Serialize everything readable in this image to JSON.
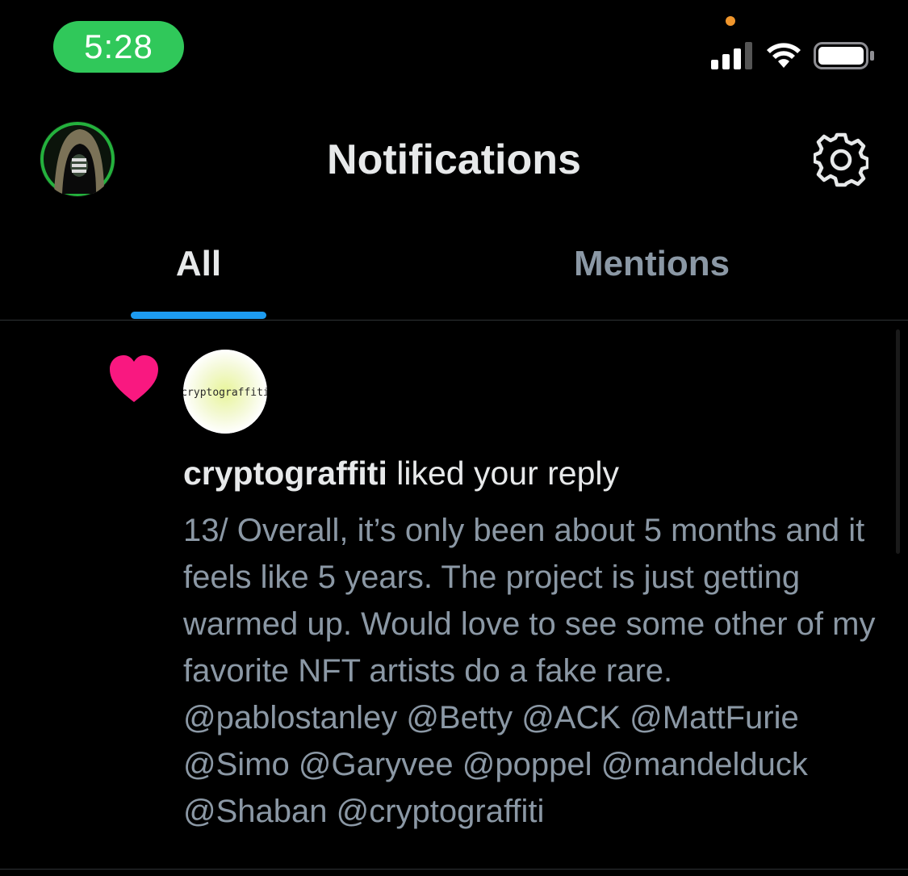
{
  "status_bar": {
    "time": "5:28",
    "colors": {
      "time_pill": "#30c85a",
      "privacy_dot": "#f0962c"
    },
    "icons": [
      "cellular-signal-icon",
      "wifi-icon",
      "battery-icon"
    ]
  },
  "header": {
    "title": "Notifications",
    "avatar_icon": "profile-avatar-hooded-figure",
    "settings_icon": "gear-icon"
  },
  "tabs": [
    {
      "label": "All",
      "selected": true
    },
    {
      "label": "Mentions",
      "selected": false
    }
  ],
  "accent_color": "#1d9bf0",
  "notification": {
    "type_icon": "heart-icon",
    "heart_color": "#f91880",
    "avatar_text": "cryptograffiti",
    "username": "cryptograffiti",
    "action": " liked your reply",
    "body": "13/ Overall, it’s only been about 5 months and it feels like 5 years. The project is just getting warmed up. Would love to see some other of my favorite NFT artists do a fake rare. @pablostanley @Betty @ACK @MattFurie @Simo @Garyvee @poppel @mandelduck @Shaban @cryptograffiti"
  }
}
